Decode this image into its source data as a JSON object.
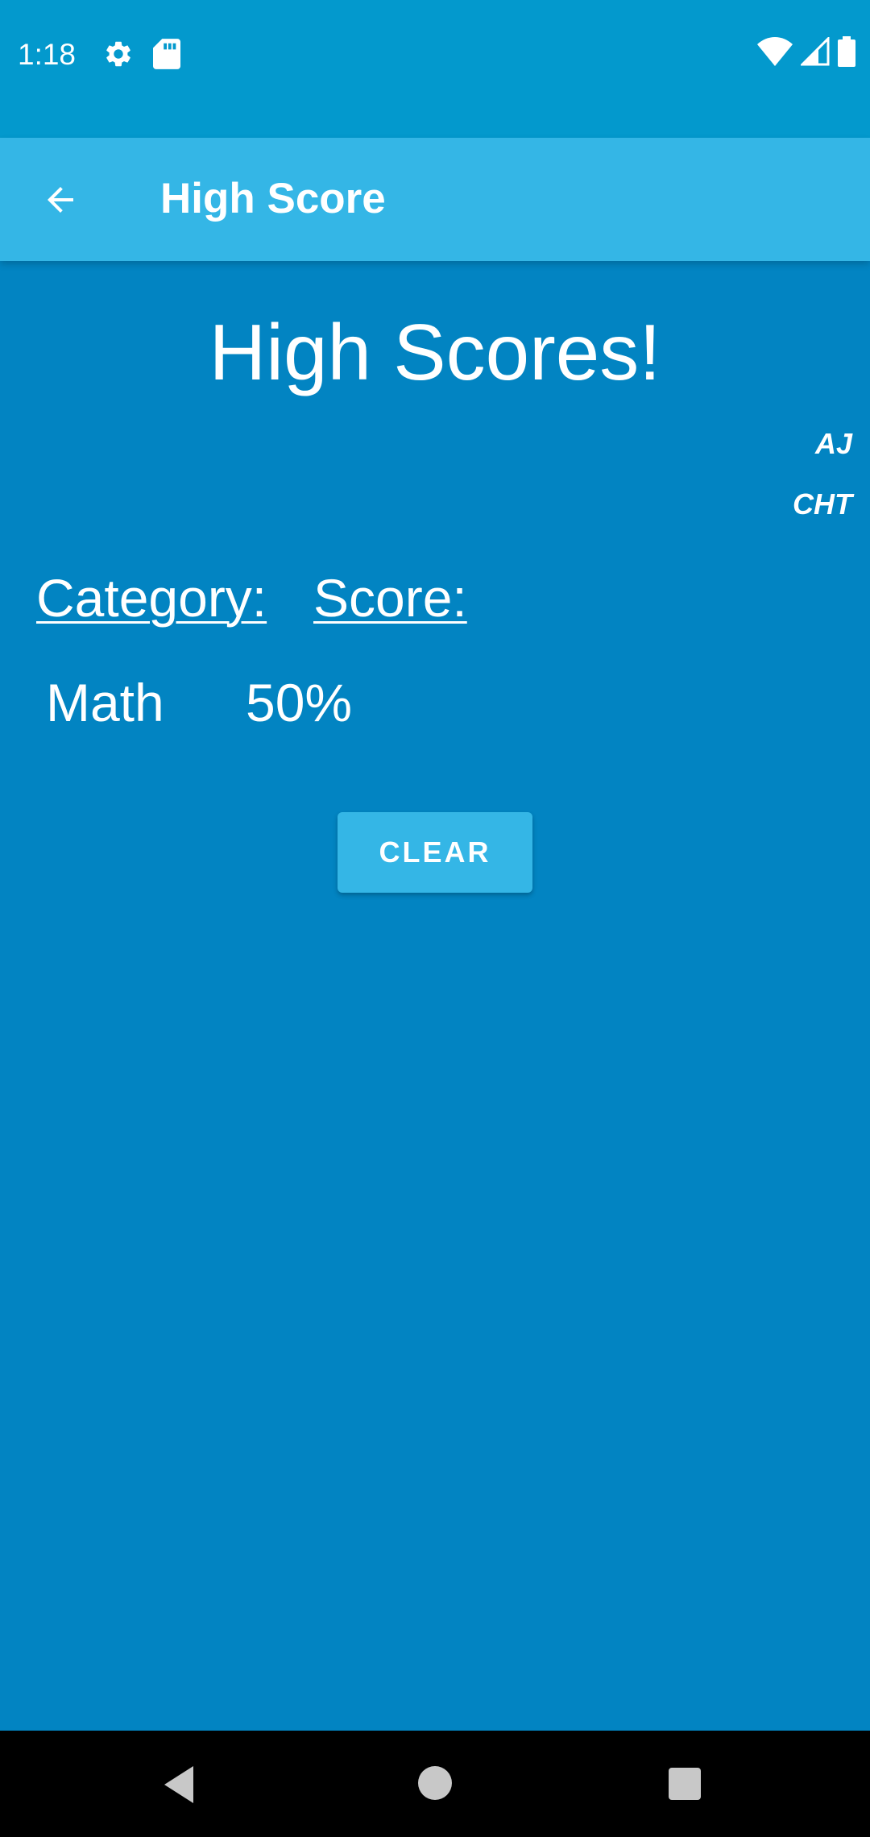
{
  "status_bar": {
    "time": "1:18",
    "left_icons": [
      "gear-icon",
      "sd-card-icon"
    ],
    "right_icons": [
      "wifi-icon",
      "signal-icon",
      "battery-icon"
    ]
  },
  "app_bar": {
    "back_icon": "arrow-back-icon",
    "title": "High Score"
  },
  "main": {
    "heading": "High Scores!",
    "credits": [
      "AJ",
      "CHT"
    ],
    "table": {
      "headers": [
        "Category:",
        "Score:"
      ],
      "rows": [
        [
          "Math",
          "50%"
        ]
      ]
    },
    "clear_label": "CLEAR"
  },
  "nav_bar": {
    "icons": [
      "nav-back-icon",
      "nav-home-icon",
      "nav-recents-icon"
    ]
  },
  "colors": {
    "status_bar": "#0399CD",
    "app_bar": "#34B6E6",
    "background": "#0284C2",
    "button": "#34B6E6",
    "text": "#FFFFFF"
  }
}
